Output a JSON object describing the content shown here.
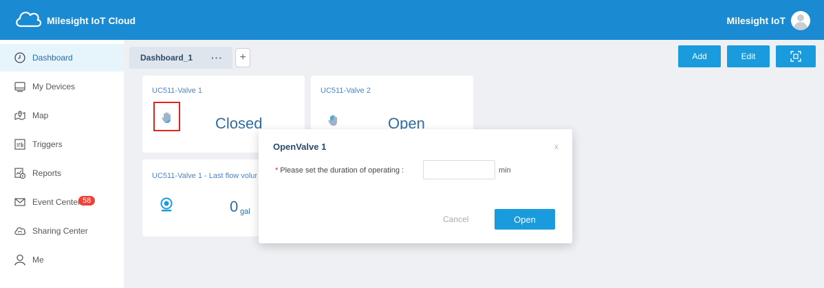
{
  "app": {
    "title": "Milesight IoT Cloud",
    "user_name": "Milesight IoT"
  },
  "sidebar": {
    "items": [
      {
        "label": "Dashboard",
        "icon": "clock-icon",
        "active": true
      },
      {
        "label": "My Devices",
        "icon": "device-icon"
      },
      {
        "label": "Map",
        "icon": "map-icon"
      },
      {
        "label": "Triggers",
        "icon": "triggers-icon"
      },
      {
        "label": "Reports",
        "icon": "reports-icon"
      },
      {
        "label": "Event Center",
        "icon": "mail-icon",
        "badge": "58"
      },
      {
        "label": "Sharing Center",
        "icon": "cloud-share-icon"
      },
      {
        "label": "Me",
        "icon": "user-icon"
      }
    ]
  },
  "dashboard": {
    "tab_label": "Dashboard_1",
    "tab_more": "···",
    "add_tab": "+",
    "buttons": {
      "add": "Add",
      "edit": "Edit"
    },
    "cards": [
      {
        "title": "UC511-Valve 1",
        "status": "Closed"
      },
      {
        "title": "UC511-Valve 2",
        "status": "Open"
      },
      {
        "title": "UC511-Valve 1 - Last flow volur",
        "value": "0",
        "unit": "gal"
      }
    ]
  },
  "modal": {
    "title": "OpenValve 1",
    "close": "x",
    "required_mark": "*",
    "field_label": "Please set the duration of operating :",
    "input_value": "",
    "unit": "min",
    "cancel_label": "Cancel",
    "confirm_label": "Open"
  },
  "colors": {
    "topbar": "#1a8bd3",
    "accent": "#1a9bde",
    "badge": "#f04134",
    "highlight": "#e2231a"
  }
}
